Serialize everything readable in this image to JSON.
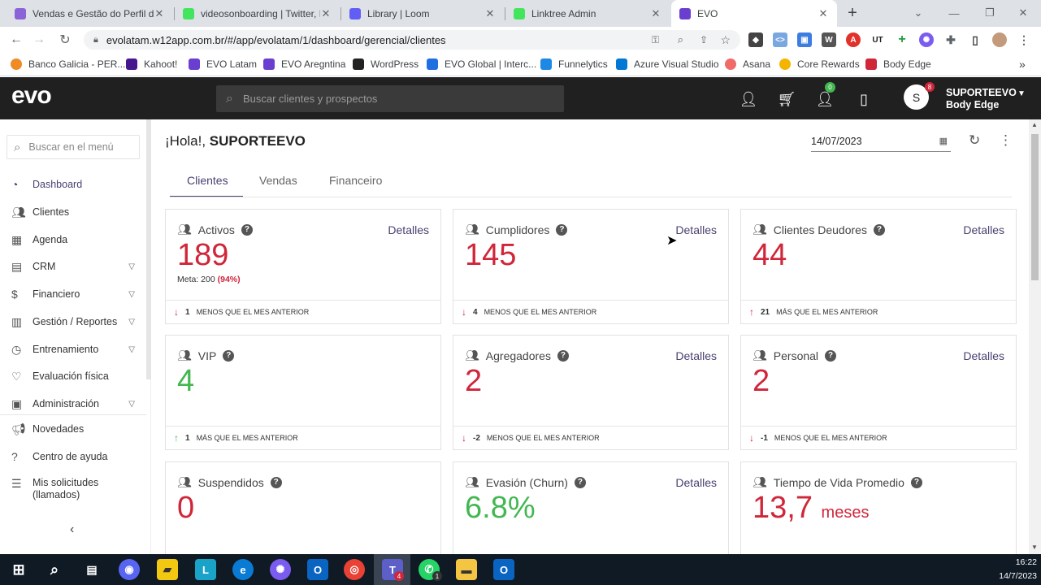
{
  "browser": {
    "tabs": [
      {
        "title": "Vendas e Gestão do Perfil de",
        "color": "#8b63d6"
      },
      {
        "title": "videosonboarding | Twitter, I",
        "color": "#43e55e"
      },
      {
        "title": "Library | Loom",
        "color": "#625df5"
      },
      {
        "title": "Linktree Admin",
        "color": "#43e55e"
      },
      {
        "title": "EVO",
        "color": "#6a3fd0"
      }
    ],
    "url": "evolatam.w12app.com.br/#/app/evolatam/1/dashboard/gerencial/clientes",
    "bookmarks": [
      {
        "label": "Banco Galicia - PER...",
        "color": "#f08a24"
      },
      {
        "label": "Kahoot!",
        "color": "#46178f"
      },
      {
        "label": "EVO Latam",
        "color": "#6a3fd0"
      },
      {
        "label": "EVO Aregntina",
        "color": "#6a3fd0"
      },
      {
        "label": "WordPress",
        "color": "#222222"
      },
      {
        "label": "EVO Global | Interc...",
        "color": "#1f6fe0"
      },
      {
        "label": "Funnelytics",
        "color": "#1e88e5"
      },
      {
        "label": "Azure Visual Studio",
        "color": "#0078d4"
      },
      {
        "label": "Asana",
        "color": "#f06a6a"
      },
      {
        "label": "Core Rewards",
        "color": "#f4b400"
      },
      {
        "label": "Body Edge",
        "color": "#d0263a"
      }
    ]
  },
  "header": {
    "logo": "evo",
    "search_placeholder": "Buscar clientes y prospectos",
    "badge_cart": "0",
    "avatar_letter": "S",
    "avatar_badge": "8",
    "user_name": "SUPORTEEVO",
    "user_company": "Body Edge"
  },
  "sidebar": {
    "search_placeholder": "Buscar en el menú",
    "items": [
      {
        "label": "Dashboard",
        "icon": "dashboard-icon",
        "chevron": false,
        "active": true
      },
      {
        "label": "Clientes",
        "icon": "users-icon",
        "chevron": false
      },
      {
        "label": "Agenda",
        "icon": "calendar-icon",
        "chevron": false
      },
      {
        "label": "CRM",
        "icon": "crm-icon",
        "chevron": true
      },
      {
        "label": "Financiero",
        "icon": "money-icon",
        "chevron": true
      },
      {
        "label": "Gestión / Reportes",
        "icon": "chart-icon",
        "chevron": true
      },
      {
        "label": "Entrenamiento",
        "icon": "timer-icon",
        "chevron": true
      },
      {
        "label": "Evaluación física",
        "icon": "heart-icon",
        "chevron": false
      },
      {
        "label": "Administración",
        "icon": "briefcase-icon",
        "chevron": true
      },
      {
        "label": "Novedades",
        "icon": "megaphone-icon",
        "chevron": false
      },
      {
        "label": "Centro de ayuda",
        "icon": "help-icon",
        "chevron": false
      },
      {
        "label": "Mis solicitudes",
        "label2": "(llamados)",
        "icon": "list-icon",
        "chevron": false
      }
    ],
    "collapse": "‹"
  },
  "main": {
    "greeting_prefix": "¡Hola!, ",
    "greeting_name": "SUPORTEEVO",
    "date": "14/07/2023",
    "tabs": [
      "Clientes",
      "Vendas",
      "Financeiro"
    ],
    "active_tab": "Clientes",
    "details_label": "Detalles",
    "cards": [
      {
        "title": "Activos",
        "value": "189",
        "color": "red",
        "meta": "Meta: 200",
        "meta_pct": "(94%)",
        "trend": "down",
        "delta": "1",
        "note": "MENOS QUE EL MES ANTERIOR",
        "details": true
      },
      {
        "title": "Cumplidores",
        "value": "145",
        "color": "red",
        "trend": "down",
        "delta": "4",
        "note": "MENOS QUE EL MES ANTERIOR",
        "details": true
      },
      {
        "title": "Clientes Deudores",
        "value": "44",
        "color": "red",
        "trend": "up",
        "delta": "21",
        "note": "MÁS QUE EL MES ANTERIOR",
        "details": true
      },
      {
        "title": "VIP",
        "value": "4",
        "color": "green",
        "trend": "up",
        "delta": "1",
        "note": "MÁS QUE EL MES ANTERIOR",
        "details": false
      },
      {
        "title": "Agregadores",
        "value": "2",
        "color": "red",
        "trend": "down",
        "delta": "-2",
        "note": "MENOS QUE EL MES ANTERIOR",
        "details": true
      },
      {
        "title": "Personal",
        "value": "2",
        "color": "red",
        "trend": "down",
        "delta": "-1",
        "note": "MENOS QUE EL MES ANTERIOR",
        "details": true
      },
      {
        "title": "Suspendidos",
        "value": "0",
        "color": "red",
        "details": false
      },
      {
        "title": "Evasión (Churn)",
        "value": "6.8%",
        "color": "green",
        "details": true
      },
      {
        "title": "Tiempo de Vida Promedio",
        "value": "13,7",
        "unit": "meses",
        "color": "red",
        "details": false
      }
    ]
  },
  "taskbar": {
    "time": "16:22",
    "date": "14/7/2023",
    "teams_badge": "4",
    "whatsapp_badge": "1"
  },
  "colors": {
    "accent": "#4a4070",
    "negative": "#d0263a",
    "positive": "#43b751",
    "header_bg": "#202020"
  }
}
